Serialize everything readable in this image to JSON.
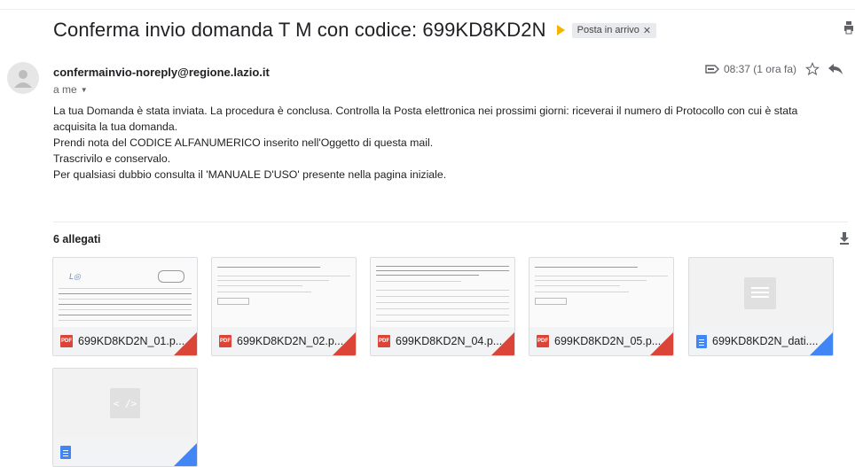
{
  "subject": "Conferma invio domanda T M con codice: 699KD8KD2N",
  "label_chip": "Posta in arrivo",
  "sender": "confermainvio-noreply@regione.lazio.it",
  "to": "a me",
  "time": "08:37 (1 ora fa)",
  "body": [
    "La tua Domanda è stata inviata. La procedura è conclusa. Controlla la Posta elettronica nei prossimi giorni: riceverai il numero di Protocollo con cui è stata acquisita la tua domanda.",
    "Prendi nota del CODICE ALFANUMERICO inserito nell'Oggetto di questa mail.",
    "Trascrivilo e conservalo.",
    "Per qualsiasi dubbio consulta il 'MANUALE D'USO' presente nella pagina iniziale."
  ],
  "attachments_title": "6 allegati",
  "attachments": [
    {
      "name": "699KD8KD2N_01.p...",
      "type": "pdf"
    },
    {
      "name": "699KD8KD2N_02.p...",
      "type": "pdf"
    },
    {
      "name": "699KD8KD2N_04.p...",
      "type": "pdf"
    },
    {
      "name": "699KD8KD2N_05.p...",
      "type": "pdf"
    },
    {
      "name": "699KD8KD2N_dati....",
      "type": "doc"
    },
    {
      "name": "",
      "type": "code"
    }
  ],
  "colors": {
    "pdf": "#db4437",
    "doc": "#4285f4",
    "important": "#f4b400"
  },
  "icons": [
    "important-marker-icon",
    "print-icon",
    "avatar-icon",
    "label-icon",
    "star-icon",
    "reply-icon",
    "download-all-icon",
    "pdf-icon",
    "doc-icon",
    "code-icon"
  ]
}
